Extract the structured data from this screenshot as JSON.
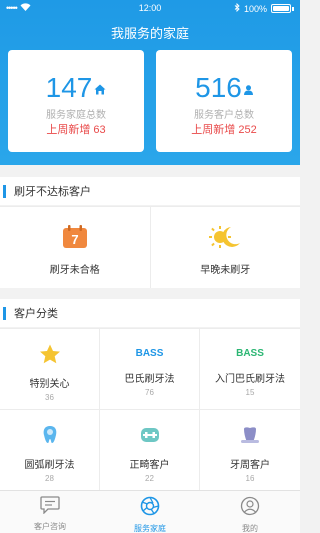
{
  "status_bar": {
    "carrier_dots": "•••••",
    "time": "12:00",
    "battery_percent": "100%"
  },
  "page_title": "我服务的家庭",
  "stats": [
    {
      "value": "147",
      "label": "服务家庭总数",
      "weekly": "上周新增 63",
      "icon": "house-icon"
    },
    {
      "value": "516",
      "label": "服务客户总数",
      "weekly": "上周新增 252",
      "icon": "person-icon"
    }
  ],
  "brushing_section": {
    "title": "刷牙不达标客户",
    "items": [
      {
        "label": "刷牙未合格",
        "icon": "calendar-icon",
        "badge": "7"
      },
      {
        "label": "早晚未刷牙",
        "icon": "sun-moon-icon"
      }
    ]
  },
  "category_section": {
    "title": "客户分类",
    "items": [
      {
        "label": "特别关心",
        "count": "36",
        "icon": "star-icon"
      },
      {
        "label": "巴氏刷牙法",
        "count": "76",
        "icon": "bass-icon",
        "icon_text": "BASS"
      },
      {
        "label": "入门巴氏刷牙法",
        "count": "15",
        "icon": "bass-beginner-icon",
        "icon_text": "BASS"
      },
      {
        "label": "圆弧刷牙法",
        "count": "28",
        "icon": "tooth-circle-icon"
      },
      {
        "label": "正畸客户",
        "count": "22",
        "icon": "braces-icon"
      },
      {
        "label": "牙周客户",
        "count": "16",
        "icon": "periodontal-icon"
      }
    ]
  },
  "tabbar": [
    {
      "label": "客户咨询",
      "icon": "chat-icon",
      "active": false
    },
    {
      "label": "服务家庭",
      "icon": "aperture-icon",
      "active": true
    },
    {
      "label": "我的",
      "icon": "profile-icon",
      "active": false
    }
  ],
  "colors": {
    "primary": "#1e96e6",
    "alert_red": "#e94a4a",
    "calendar_orange": "#f0883e",
    "star_yellow": "#f5c431",
    "bass_blue": "#1e96e6",
    "bass_green": "#2bb673"
  }
}
